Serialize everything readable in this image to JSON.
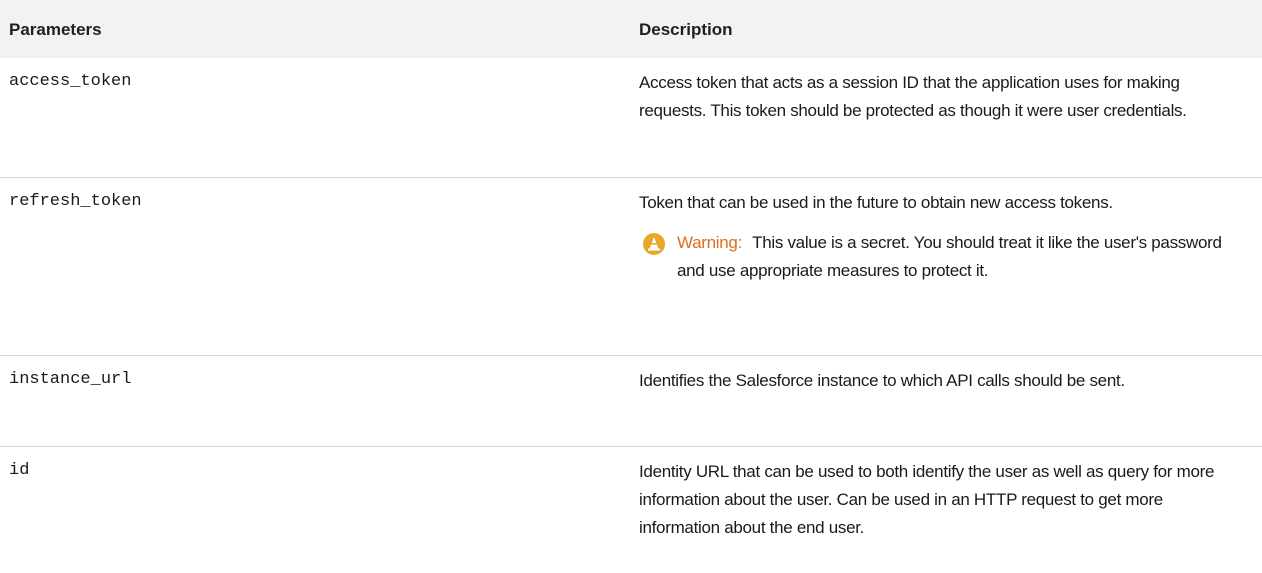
{
  "header": {
    "parameters": "Parameters",
    "description": "Description"
  },
  "rows": [
    {
      "param": "access_token",
      "desc": "Access token that acts as a session ID that the application uses for making requests. This token should be protected as though it were user credentials."
    },
    {
      "param": "refresh_token",
      "desc": "Token that can be used in the future to obtain new access tokens.",
      "warning_label": "Warning:",
      "warning_text": "This value is a secret. You should treat it like the user's password and use appropriate measures to protect it."
    },
    {
      "param": "instance_url",
      "desc": "Identifies the Salesforce instance to which API calls should be sent."
    },
    {
      "param": "id",
      "desc": "Identity URL that can be used to both identify the user as well as query for more information about the user. Can be used in an HTTP request to get more information about the end user."
    }
  ],
  "colors": {
    "header_bg": "#f2f2f2",
    "warning_icon": "#e7a82a",
    "warning_label": "#e06d1f",
    "divider": "#d6d6d6"
  },
  "icons": {
    "warning": "warning-cone-icon"
  }
}
